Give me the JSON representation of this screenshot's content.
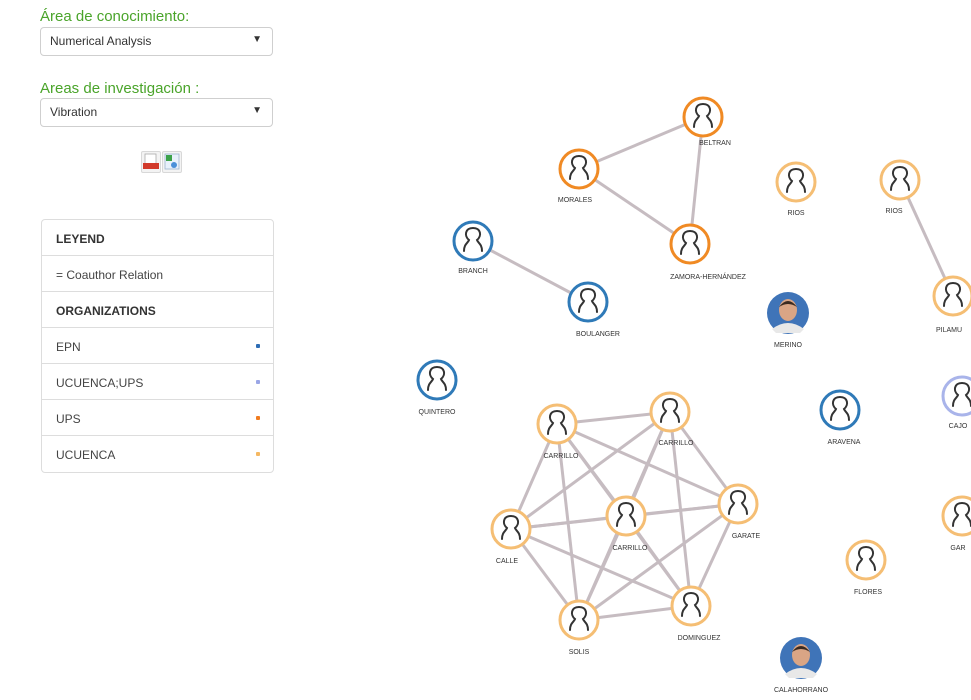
{
  "filters": {
    "area_label": "Área de conocimiento:",
    "area_value": "Numerical Analysis",
    "research_label": "Areas de investigación :",
    "research_value": "Vibration"
  },
  "export": {
    "pdf_icon": "pdf-export-icon",
    "image_icon": "image-export-icon"
  },
  "legend": {
    "title": "LEYEND",
    "relation": "Coauthor Relation",
    "organizations_title": "ORGANIZATIONS",
    "organizations": [
      {
        "name": "EPN",
        "color": "#2d6db5"
      },
      {
        "name": "UCUENCA;UPS",
        "color": "#9aa6e6"
      },
      {
        "name": "UPS",
        "color": "#f07c20"
      },
      {
        "name": "UCUENCA",
        "color": "#f5b862"
      }
    ]
  },
  "graph": {
    "colors": {
      "epn": "#2f7ab8",
      "ups": "#f08a24",
      "ucuenca": "#f5be74",
      "ucuenca_ups": "#a9b4ea",
      "edge": "#c6bcc1"
    },
    "nodes": [
      {
        "id": "beltran",
        "label": "BELTRAN",
        "org": "ups"
      },
      {
        "id": "morales",
        "label": "MORALES",
        "org": "ups"
      },
      {
        "id": "zamora",
        "label": "ZAMORA-HERNÁNDEZ",
        "org": "ups"
      },
      {
        "id": "rios1",
        "label": "RIOS",
        "org": "ucuenca"
      },
      {
        "id": "rios2",
        "label": "RIOS",
        "org": "ucuenca"
      },
      {
        "id": "branch",
        "label": "BRANCH",
        "org": "epn"
      },
      {
        "id": "boulanger",
        "label": "BOULANGER",
        "org": "epn"
      },
      {
        "id": "merino",
        "label": "MERINO",
        "org": "photo"
      },
      {
        "id": "pilamu",
        "label": "PILAMU",
        "org": "ucuenca"
      },
      {
        "id": "quintero",
        "label": "QUINTERO",
        "org": "epn"
      },
      {
        "id": "carrillo1",
        "label": "CARRILLO",
        "org": "ucuenca"
      },
      {
        "id": "carrillo2",
        "label": "CARRILLO",
        "org": "ucuenca"
      },
      {
        "id": "aravena",
        "label": "ARAVENA",
        "org": "epn"
      },
      {
        "id": "cajo",
        "label": "CAJO",
        "org": "ucuenca_ups"
      },
      {
        "id": "carrillo3",
        "label": "CARRILLO",
        "org": "ucuenca"
      },
      {
        "id": "garate",
        "label": "GARATE",
        "org": "ucuenca"
      },
      {
        "id": "gar",
        "label": "GAR",
        "org": "ucuenca"
      },
      {
        "id": "calle",
        "label": "CALLE",
        "org": "ucuenca"
      },
      {
        "id": "flores",
        "label": "FLORES",
        "org": "ucuenca"
      },
      {
        "id": "solis",
        "label": "SOLIS",
        "org": "ucuenca"
      },
      {
        "id": "dominguez",
        "label": "DOMINGUEZ",
        "org": "ucuenca"
      },
      {
        "id": "calahorrano",
        "label": "CALAHORRANO",
        "org": "photo"
      }
    ],
    "edges": [
      [
        "beltran",
        "morales"
      ],
      [
        "beltran",
        "zamora"
      ],
      [
        "morales",
        "zamora"
      ],
      [
        "branch",
        "boulanger"
      ],
      [
        "rios2",
        "pilamu"
      ],
      [
        "carrillo1",
        "carrillo2"
      ],
      [
        "carrillo1",
        "carrillo3"
      ],
      [
        "carrillo1",
        "garate"
      ],
      [
        "carrillo1",
        "calle"
      ],
      [
        "carrillo1",
        "solis"
      ],
      [
        "carrillo1",
        "dominguez"
      ],
      [
        "carrillo2",
        "carrillo3"
      ],
      [
        "carrillo2",
        "garate"
      ],
      [
        "carrillo2",
        "calle"
      ],
      [
        "carrillo2",
        "solis"
      ],
      [
        "carrillo2",
        "dominguez"
      ],
      [
        "carrillo3",
        "garate"
      ],
      [
        "carrillo3",
        "calle"
      ],
      [
        "carrillo3",
        "solis"
      ],
      [
        "carrillo3",
        "dominguez"
      ],
      [
        "garate",
        "calle"
      ],
      [
        "garate",
        "solis"
      ],
      [
        "garate",
        "dominguez"
      ],
      [
        "calle",
        "solis"
      ],
      [
        "calle",
        "dominguez"
      ],
      [
        "solis",
        "dominguez"
      ]
    ]
  }
}
